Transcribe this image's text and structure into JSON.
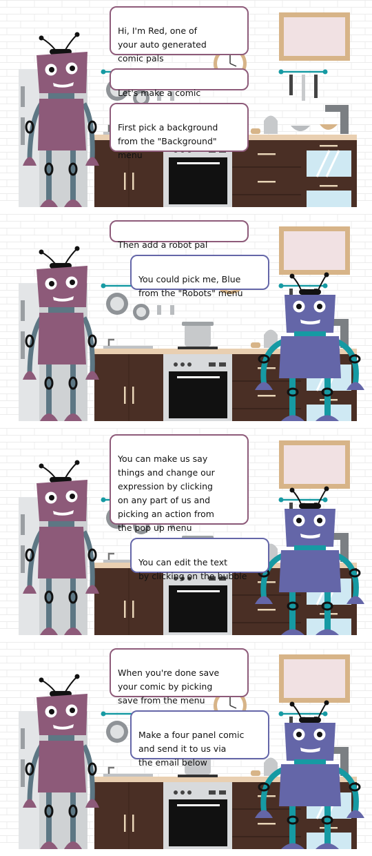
{
  "panels": [
    {
      "bubbles": [
        {
          "text": "Hi, I'm Red, one of\nyour auto generated\ncomic pals",
          "speaker": "red"
        },
        {
          "text": "Let's make a comic together",
          "speaker": "red"
        },
        {
          "text": "First pick a background\nfrom the \"Background\"\nmenu",
          "speaker": "red"
        }
      ]
    },
    {
      "bubbles": [
        {
          "text": "Then add a robot pal",
          "speaker": "red"
        },
        {
          "text": "You could pick me, Blue\nfrom the \"Robots\" menu",
          "speaker": "blue"
        }
      ]
    },
    {
      "bubbles": [
        {
          "text": "You can make us say\nthings and change our\nexpression by clicking\non any part of us and\npicking an action from\nthe pop up menu",
          "speaker": "red"
        },
        {
          "text": "You can edit the text\nby clicking on the bubble",
          "speaker": "blue"
        }
      ]
    },
    {
      "bubbles": [
        {
          "text": "When you're done save\nyour comic by picking\nsave from the menu",
          "speaker": "red"
        },
        {
          "text": "Make a four panel comic\nand send it to us via\nthe email below",
          "speaker": "blue"
        }
      ]
    }
  ],
  "colors": {
    "red_robot": "#8d5a79",
    "blue_robot": "#6466a8",
    "cabinet": "#4a2f25",
    "teal": "#169aa3"
  }
}
